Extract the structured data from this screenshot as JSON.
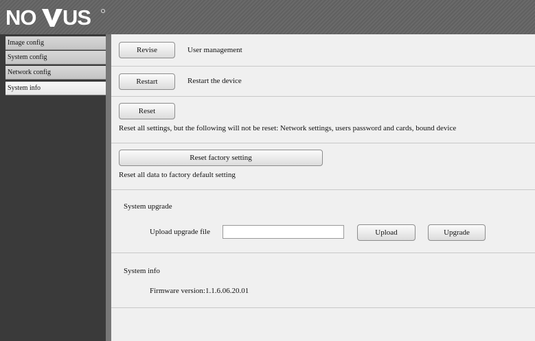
{
  "brand": {
    "logo_text": "NOVUS"
  },
  "sidebar": {
    "items": [
      {
        "label": "Image config"
      },
      {
        "label": "System config"
      },
      {
        "label": "Network config"
      },
      {
        "label": "System info"
      }
    ],
    "active": "System info"
  },
  "main": {
    "revise": {
      "button": "Revise",
      "description": "User management"
    },
    "restart": {
      "button": "Restart",
      "description": "Restart the device"
    },
    "reset": {
      "button": "Reset",
      "description": "Reset all settings, but the following will not be reset: Network settings, users password and cards, bound device"
    },
    "factory": {
      "button": "Reset factory setting",
      "description": "Reset all data to factory default setting"
    },
    "upgrade": {
      "title": "System upgrade",
      "file_label": "Upload upgrade file",
      "file_value": "",
      "upload_button": "Upload",
      "upgrade_button": "Upgrade"
    },
    "info": {
      "title": "System info",
      "firmware": "Firmware version:1.1.6.06.20.01"
    }
  }
}
